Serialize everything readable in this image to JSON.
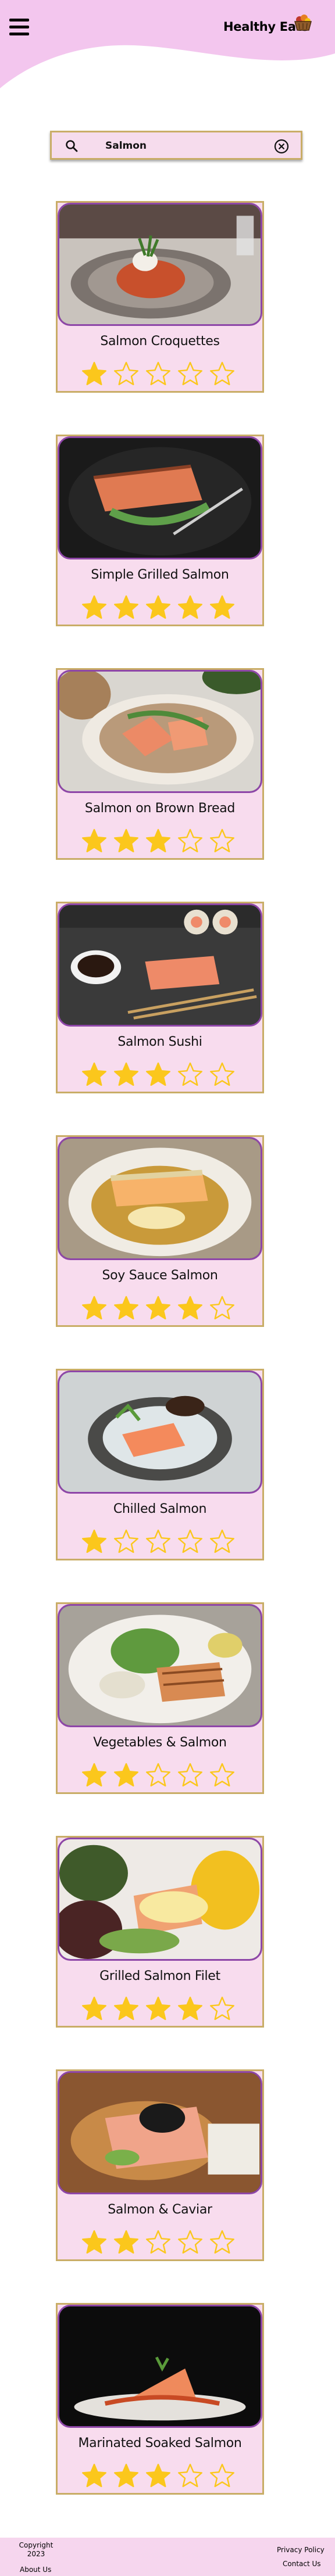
{
  "header": {
    "logo_text": "Healthy Eats",
    "menu_icon": "hamburger-menu-icon",
    "logo_icon": "basket-icon"
  },
  "search": {
    "value": "Salmon",
    "search_icon": "search-icon",
    "clear_icon": "clear-icon"
  },
  "colors": {
    "header_wave": "#f3c6ee",
    "card_background": "#f8dcee",
    "card_border": "#c9ad67",
    "photo_border": "#8e46a8",
    "star_fill": "#fbc71c",
    "footer_background": "#f6d6ee"
  },
  "recipes": [
    {
      "title": "Salmon Croquettes",
      "rating": 1,
      "max_rating": 5
    },
    {
      "title": "Simple Grilled Salmon",
      "rating": 5,
      "max_rating": 5
    },
    {
      "title": "Salmon on Brown Bread",
      "rating": 3,
      "max_rating": 5
    },
    {
      "title": "Salmon Sushi",
      "rating": 3,
      "max_rating": 5
    },
    {
      "title": "Soy Sauce Salmon",
      "rating": 4,
      "max_rating": 5
    },
    {
      "title": "Chilled Salmon",
      "rating": 1,
      "max_rating": 5
    },
    {
      "title": "Vegetables & Salmon",
      "rating": 2,
      "max_rating": 5
    },
    {
      "title": "Grilled Salmon Filet",
      "rating": 4,
      "max_rating": 5
    },
    {
      "title": "Salmon & Caviar",
      "rating": 2,
      "max_rating": 5
    },
    {
      "title": "Marinated Soaked Salmon",
      "rating": 3,
      "max_rating": 5
    }
  ],
  "footer": {
    "copyright": "Copyright\n2023",
    "about": "About Us",
    "privacy": "Privacy Policy",
    "contact": "Contact Us"
  }
}
